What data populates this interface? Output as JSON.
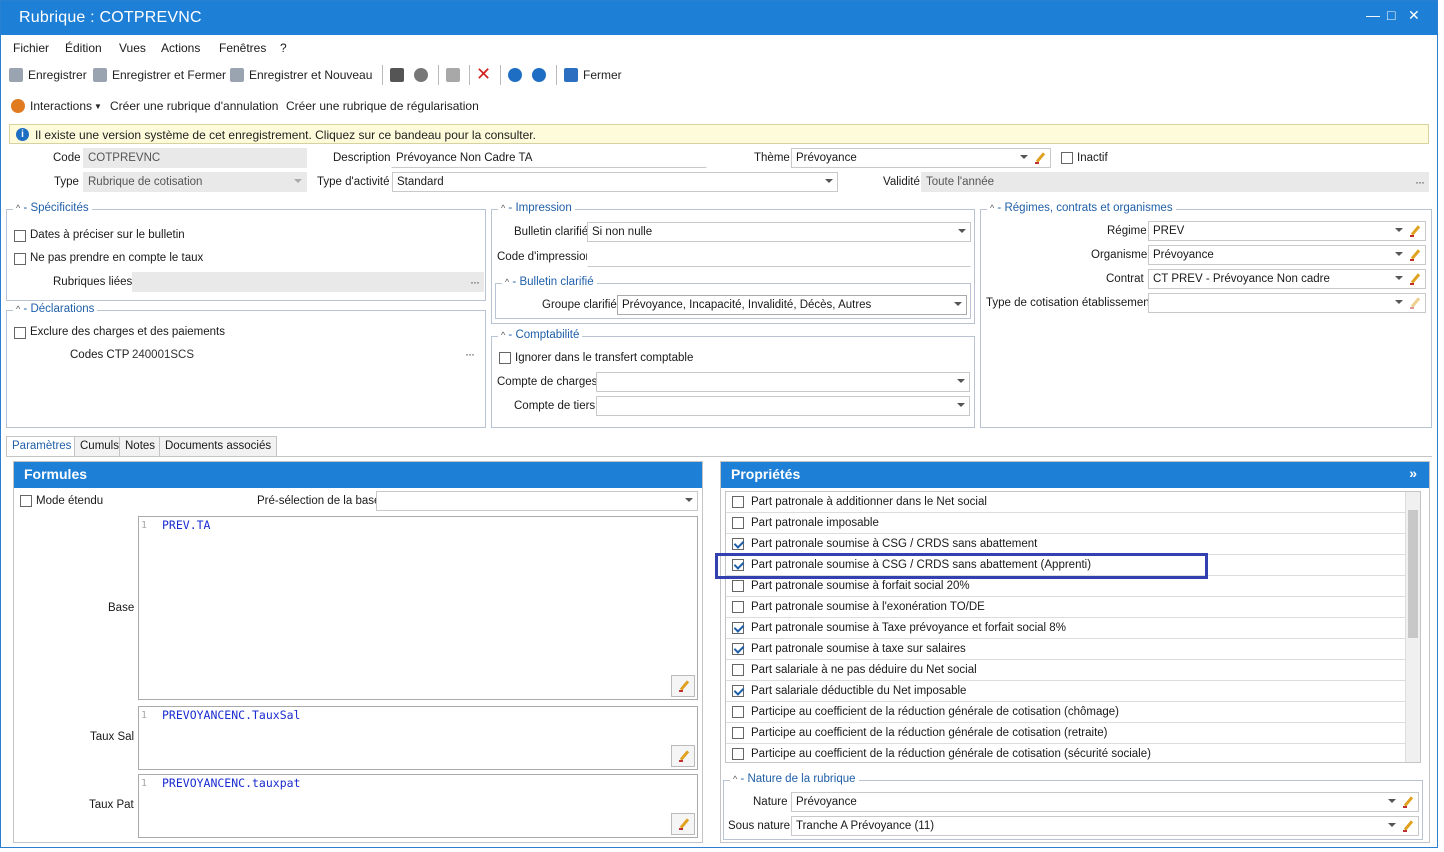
{
  "window": {
    "title": "Rubrique : COTPREVNC",
    "minimize": "—",
    "maximize": "□",
    "close": "✕"
  },
  "menu": [
    "Fichier",
    "Édition",
    "Vues",
    "Actions",
    "Fenêtres",
    "?"
  ],
  "toolbar": {
    "save": "Enregistrer",
    "save_close": "Enregistrer et Fermer",
    "save_new": "Enregistrer et Nouveau",
    "close": "Fermer"
  },
  "actions": {
    "interactions": "Interactions",
    "cancel_rubric": "Créer une rubrique d'annulation",
    "regul_rubric": "Créer une rubrique de régularisation"
  },
  "banner": "Il existe une version système de cet enregistrement. Cliquez sur ce bandeau pour la consulter.",
  "header": {
    "code_label": "Code",
    "code": "COTPREVNC",
    "desc_label": "Description",
    "desc": "Prévoyance Non Cadre TA",
    "theme_label": "Thème",
    "theme": "Prévoyance",
    "inactif": "Inactif",
    "type_label": "Type",
    "type": "Rubrique de cotisation",
    "activity_label": "Type d'activité",
    "activity": "Standard",
    "validity_label": "Validité",
    "validity": "Toute l'année"
  },
  "specificites": {
    "title": "Spécificités",
    "dates": "Dates à préciser sur le bulletin",
    "taux": "Ne pas prendre en compte le taux",
    "liees": "Rubriques liées"
  },
  "declarations": {
    "title": "Déclarations",
    "exclure": "Exclure des charges et des paiements",
    "ctp_label": "Codes CTP",
    "ctp": "240001SCS"
  },
  "impression": {
    "title": "Impression",
    "bulletin_label": "Bulletin clarifié",
    "bulletin": "Si non nulle",
    "code_label": "Code d'impression",
    "sub_title": "Bulletin clarifié",
    "groupe_label": "Groupe clarifié",
    "groupe": "Prévoyance, Incapacité, Invalidité, Décès, Autres"
  },
  "comptabilite": {
    "title": "Comptabilité",
    "ignorer": "Ignorer dans le transfert comptable",
    "charges": "Compte de charges",
    "tiers": "Compte de tiers"
  },
  "regimes": {
    "title": "Régimes, contrats et organismes",
    "regime_label": "Régime",
    "regime": "PREV",
    "org_label": "Organisme",
    "org": "Prévoyance",
    "contrat_label": "Contrat",
    "contrat": "CT PREV - Prévoyance Non cadre",
    "type_label": "Type de cotisation établissement"
  },
  "tabs": [
    "Paramètres",
    "Cumuls",
    "Notes",
    "Documents associés"
  ],
  "formules": {
    "title": "Formules",
    "mode": "Mode étendu",
    "presel": "Pré-sélection de la base",
    "base_label": "Base",
    "base": "PREV.TA",
    "sal_label": "Taux Sal",
    "sal": "PREVOYANCENC.TauxSal",
    "pat_label": "Taux Pat",
    "pat": "PREVOYANCENC.tauxpat",
    "line": "1"
  },
  "proprietes": {
    "title": "Propriétés",
    "chevron": "»",
    "items": [
      {
        "label": "Part patronale à additionner dans le Net social",
        "checked": false
      },
      {
        "label": "Part patronale imposable",
        "checked": false
      },
      {
        "label": "Part patronale soumise à CSG / CRDS sans abattement",
        "checked": true
      },
      {
        "label": "Part patronale soumise à CSG / CRDS sans abattement (Apprenti)",
        "checked": true
      },
      {
        "label": "Part patronale soumise à forfait social 20%",
        "checked": false
      },
      {
        "label": "Part patronale soumise à l'exonération TO/DE",
        "checked": false
      },
      {
        "label": "Part patronale soumise à Taxe prévoyance et forfait social 8%",
        "checked": true
      },
      {
        "label": "Part patronale soumise à taxe sur salaires",
        "checked": true
      },
      {
        "label": "Part salariale à ne pas déduire du Net social",
        "checked": false
      },
      {
        "label": "Part salariale déductible du Net imposable",
        "checked": true
      },
      {
        "label": "Participe au coefficient de la réduction générale de cotisation (chômage)",
        "checked": false
      },
      {
        "label": "Participe au coefficient de la réduction générale de cotisation (retraite)",
        "checked": false
      },
      {
        "label": "Participe au coefficient de la réduction générale de cotisation (sécurité sociale)",
        "checked": false
      }
    ]
  },
  "nature": {
    "title": "Nature de la rubrique",
    "nature_label": "Nature",
    "nature": "Prévoyance",
    "sous_label": "Sous nature",
    "sous": "Tranche A Prévoyance (11)"
  }
}
